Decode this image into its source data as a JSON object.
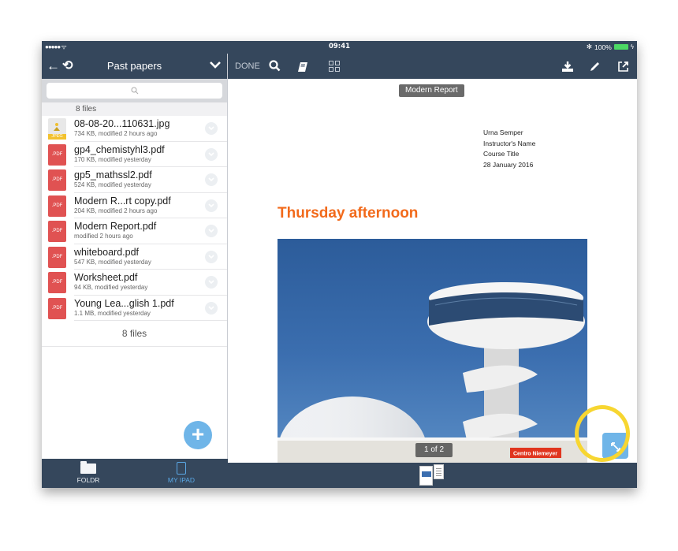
{
  "statusbar": {
    "signal": "●●●●● ᯤ",
    "time": "09:41",
    "bluetooth": "✻",
    "battery_percent": "100%",
    "battery_level": 1.0
  },
  "sidebar": {
    "header": {
      "back_icon": "←",
      "history_icon": "⟲",
      "title": "Past papers",
      "chevron_icon": "⌄"
    },
    "search": {
      "placeholder": "🔍"
    },
    "files_count_top": "8 files",
    "files": [
      {
        "name": "08-08-20...110631.jpg",
        "meta": "734 KB, modified 2 hours ago",
        "type": "JPEG"
      },
      {
        "name": "gp4_chemistyhl3.pdf",
        "meta": "170 KB, modified yesterday",
        "type": ".PDF"
      },
      {
        "name": "gp5_mathssl2.pdf",
        "meta": "524 KB, modified yesterday",
        "type": ".PDF"
      },
      {
        "name": "Modern R...rt copy.pdf",
        "meta": "204 KB, modified 2 hours ago",
        "type": ".PDF"
      },
      {
        "name": "Modern Report.pdf",
        "meta": "modified 2 hours ago",
        "type": ".PDF"
      },
      {
        "name": "whiteboard.pdf",
        "meta": "547 KB, modified yesterday",
        "type": ".PDF"
      },
      {
        "name": "Worksheet.pdf",
        "meta": "94 KB, modified yesterday",
        "type": ".PDF"
      },
      {
        "name": "Young Lea...glish 1.pdf",
        "meta": "1.1 MB, modified yesterday",
        "type": ".PDF"
      }
    ],
    "files_count_bottom": "8 files",
    "fab_label": "+",
    "tabs": [
      {
        "label": "FOLDR",
        "icon": "folder-icon"
      },
      {
        "label": "MY IPAD",
        "icon": "ipad-icon",
        "active": true
      }
    ]
  },
  "viewer": {
    "toolbar": {
      "done_label": "DONE",
      "search_icon": "⚲",
      "book_icon": "📘",
      "download_icon": "⤓",
      "pencil_icon": "✎",
      "share_icon": "⇗"
    },
    "document": {
      "badge": "Modern Report",
      "meta_lines": [
        "Urna Semper",
        "Instructor's Name",
        "Course Title",
        "28 January 2016"
      ],
      "title": "Thursday afternoon",
      "photo_caption": "Centro Niemeyer"
    },
    "page_indicator": "1 of 2",
    "expand_icon": "⤡"
  },
  "colors": {
    "header_bg": "#35475c",
    "accent_blue": "#6fb5e8",
    "title_orange": "#f26a1b",
    "pdf_red": "#e05252",
    "highlight_yellow": "#f7d631"
  }
}
